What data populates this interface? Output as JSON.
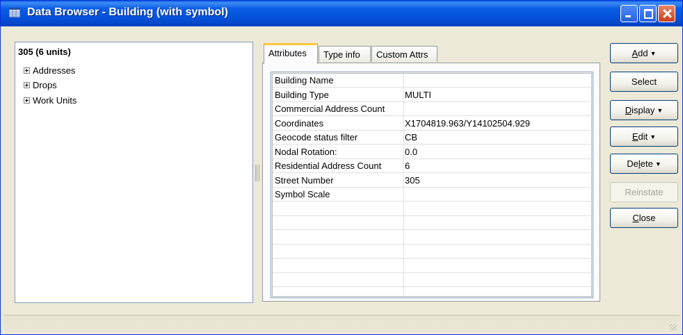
{
  "window": {
    "title": "Data Browser - Building (with symbol)"
  },
  "tree": {
    "root": "305 (6 units)",
    "items": [
      "Addresses",
      "Drops",
      "Work Units"
    ]
  },
  "tabs": [
    "Attributes",
    "Type info",
    "Custom Attrs"
  ],
  "attributes": [
    {
      "name": "Building Name",
      "value": ""
    },
    {
      "name": "Building Type",
      "value": "MULTI"
    },
    {
      "name": "Commercial Address Count",
      "value": ""
    },
    {
      "name": "Coordinates",
      "value": "X1704819.963/Y14102504.929"
    },
    {
      "name": "Geocode status filter",
      "value": "CB"
    },
    {
      "name": "Nodal Rotation:",
      "value": "0.0"
    },
    {
      "name": "Residential Address Count",
      "value": "6"
    },
    {
      "name": "Street Number",
      "value": "305"
    },
    {
      "name": "Symbol Scale",
      "value": ""
    }
  ],
  "buttons": {
    "add": {
      "pre": "",
      "acc": "A",
      "post": "dd"
    },
    "select": "Select",
    "display": {
      "pre": "",
      "acc": "D",
      "post": "isplay"
    },
    "edit": {
      "pre": "",
      "acc": "E",
      "post": "dit"
    },
    "delete": {
      "pre": "De",
      "acc": "l",
      "post": "ete"
    },
    "reinstate": "Reinstate",
    "close": {
      "pre": "",
      "acc": "C",
      "post": "lose"
    }
  },
  "colors": {
    "titlebar": "#0550d8",
    "active_tab_accent": "#ffc83c",
    "window_bg": "#ece9d8"
  }
}
